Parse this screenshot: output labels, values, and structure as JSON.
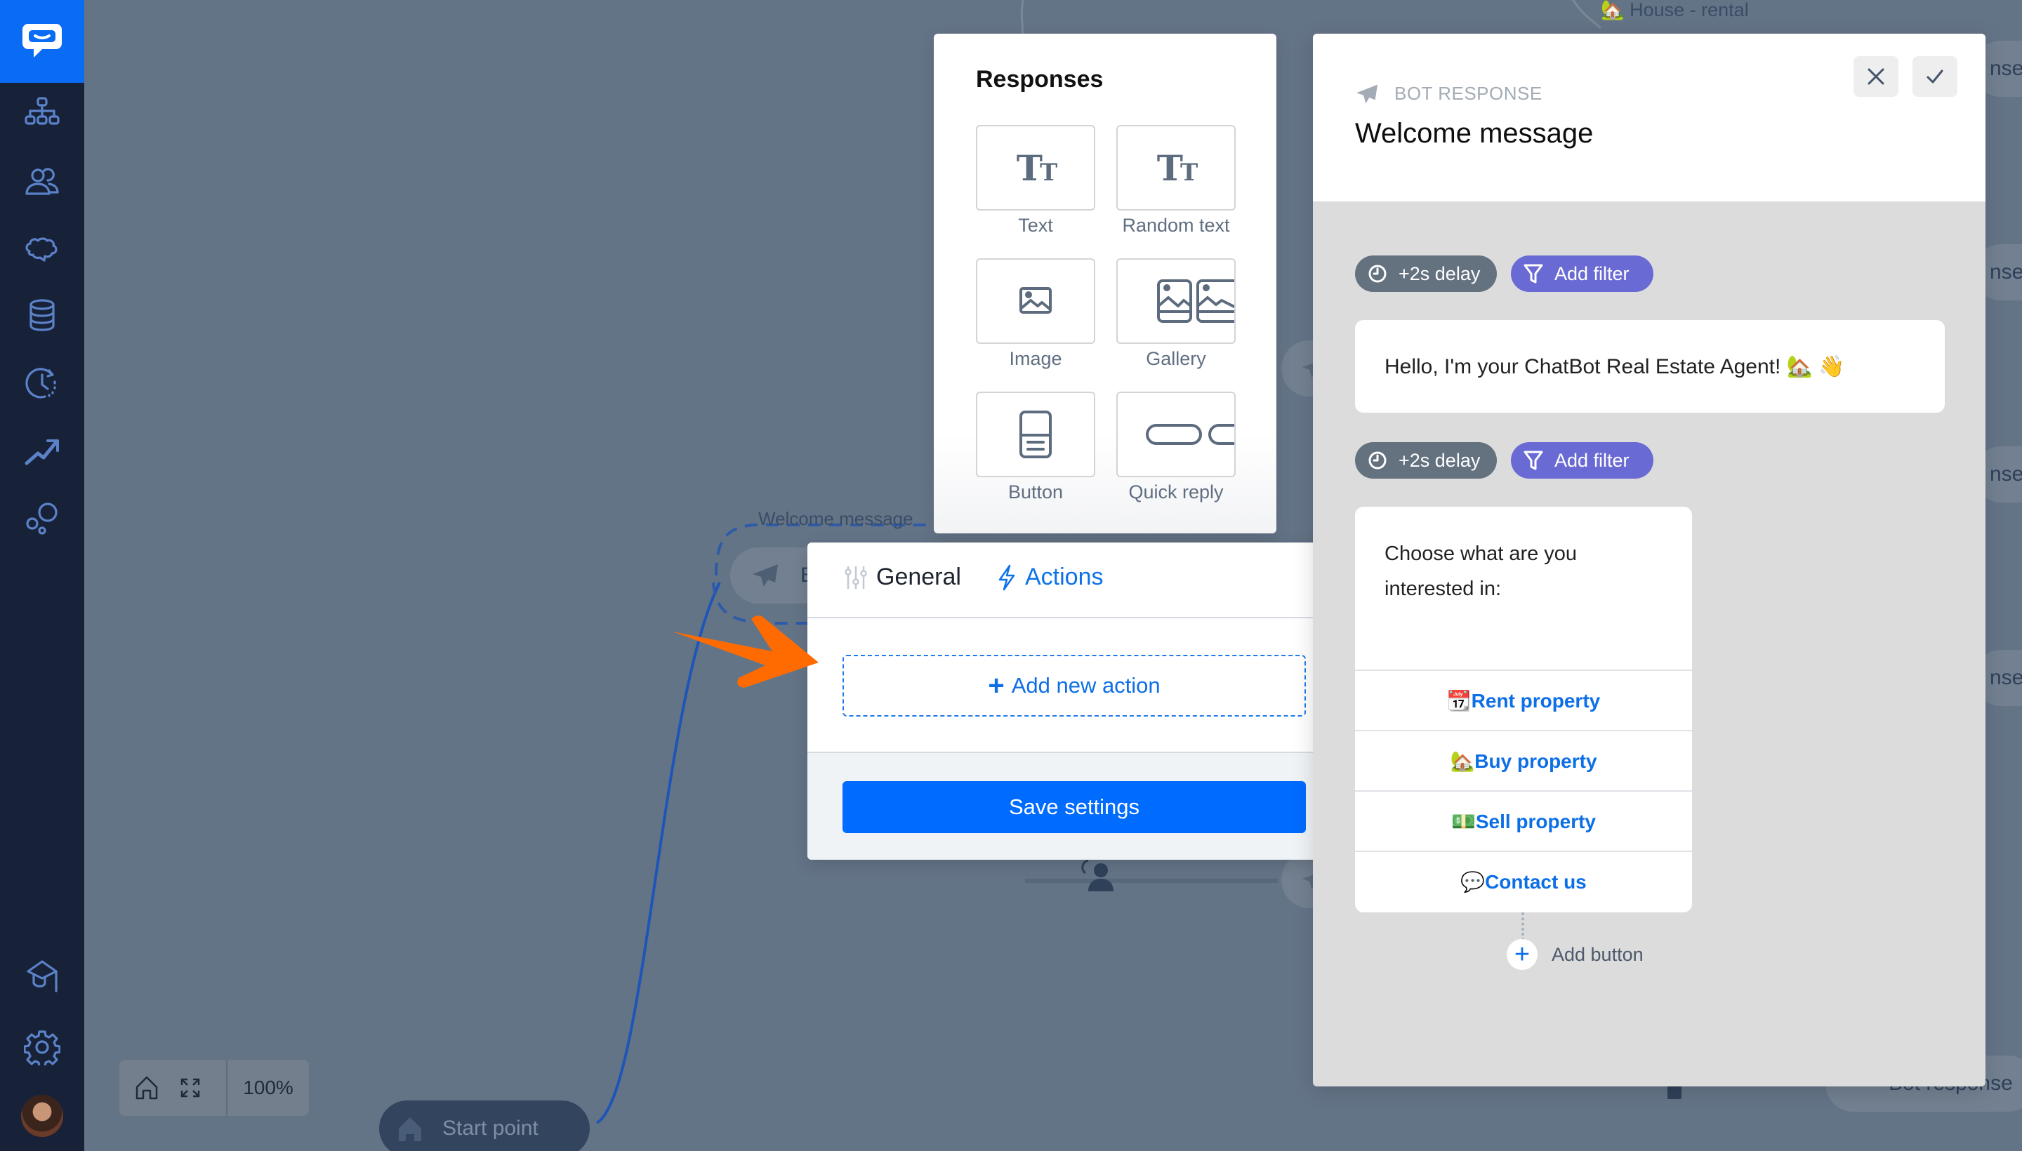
{
  "sidebar": {
    "logo": "chatbot-logo",
    "items": [
      {
        "name": "stories",
        "icon": "sitemap-icon"
      },
      {
        "name": "audience",
        "icon": "users-icon"
      },
      {
        "name": "ai-training",
        "icon": "brain-icon"
      },
      {
        "name": "data",
        "icon": "database-icon"
      },
      {
        "name": "archive",
        "icon": "history-clock-icon"
      },
      {
        "name": "reports",
        "icon": "trend-up-icon"
      },
      {
        "name": "integrations",
        "icon": "bubbles-icon"
      }
    ],
    "bottom": [
      {
        "name": "academy",
        "icon": "graduation-cap-icon"
      },
      {
        "name": "settings",
        "icon": "gear-icon"
      }
    ]
  },
  "canvas": {
    "bg_labels": {
      "house_rental": "🏡 House - rental",
      "welcome_message": "Welcome message",
      "bot_node_fragment": "Bo",
      "response_fragment": "nse",
      "bot_response": "Bot response"
    },
    "start_point": "Start point",
    "zoom_level": "100%"
  },
  "responses": {
    "title": "Responses",
    "items": [
      {
        "label": "Text",
        "icon": "text-icon"
      },
      {
        "label": "Random text",
        "icon": "random-text-icon"
      },
      {
        "label": "Image",
        "icon": "image-icon"
      },
      {
        "label": "Gallery",
        "icon": "gallery-icon"
      },
      {
        "label": "Button",
        "icon": "button-icon"
      },
      {
        "label": "Quick reply",
        "icon": "quick-reply-icon"
      }
    ]
  },
  "settings": {
    "tabs": [
      {
        "label": "General",
        "active": false
      },
      {
        "label": "Actions",
        "active": true
      }
    ],
    "add_action": "Add new action",
    "save": "Save settings"
  },
  "bot_panel": {
    "kicker": "BOT RESPONSE",
    "title": "Welcome message",
    "delay_label": "+2s delay",
    "filter_label": "Add filter",
    "message": "Hello, I'm your ChatBot Real Estate Agent! 🏡 👋",
    "question": "Choose what are you interested in:",
    "options": [
      "📆Rent property",
      "🏡Buy property",
      "💵Sell property",
      "💬Contact us"
    ],
    "add_button": "Add button"
  },
  "colors": {
    "accent": "#006bff",
    "sidebar": "#172238",
    "canvas": "#647487",
    "filter": "#6a6ad5",
    "delay": "#64717f",
    "arrow": "#ff6b00"
  }
}
